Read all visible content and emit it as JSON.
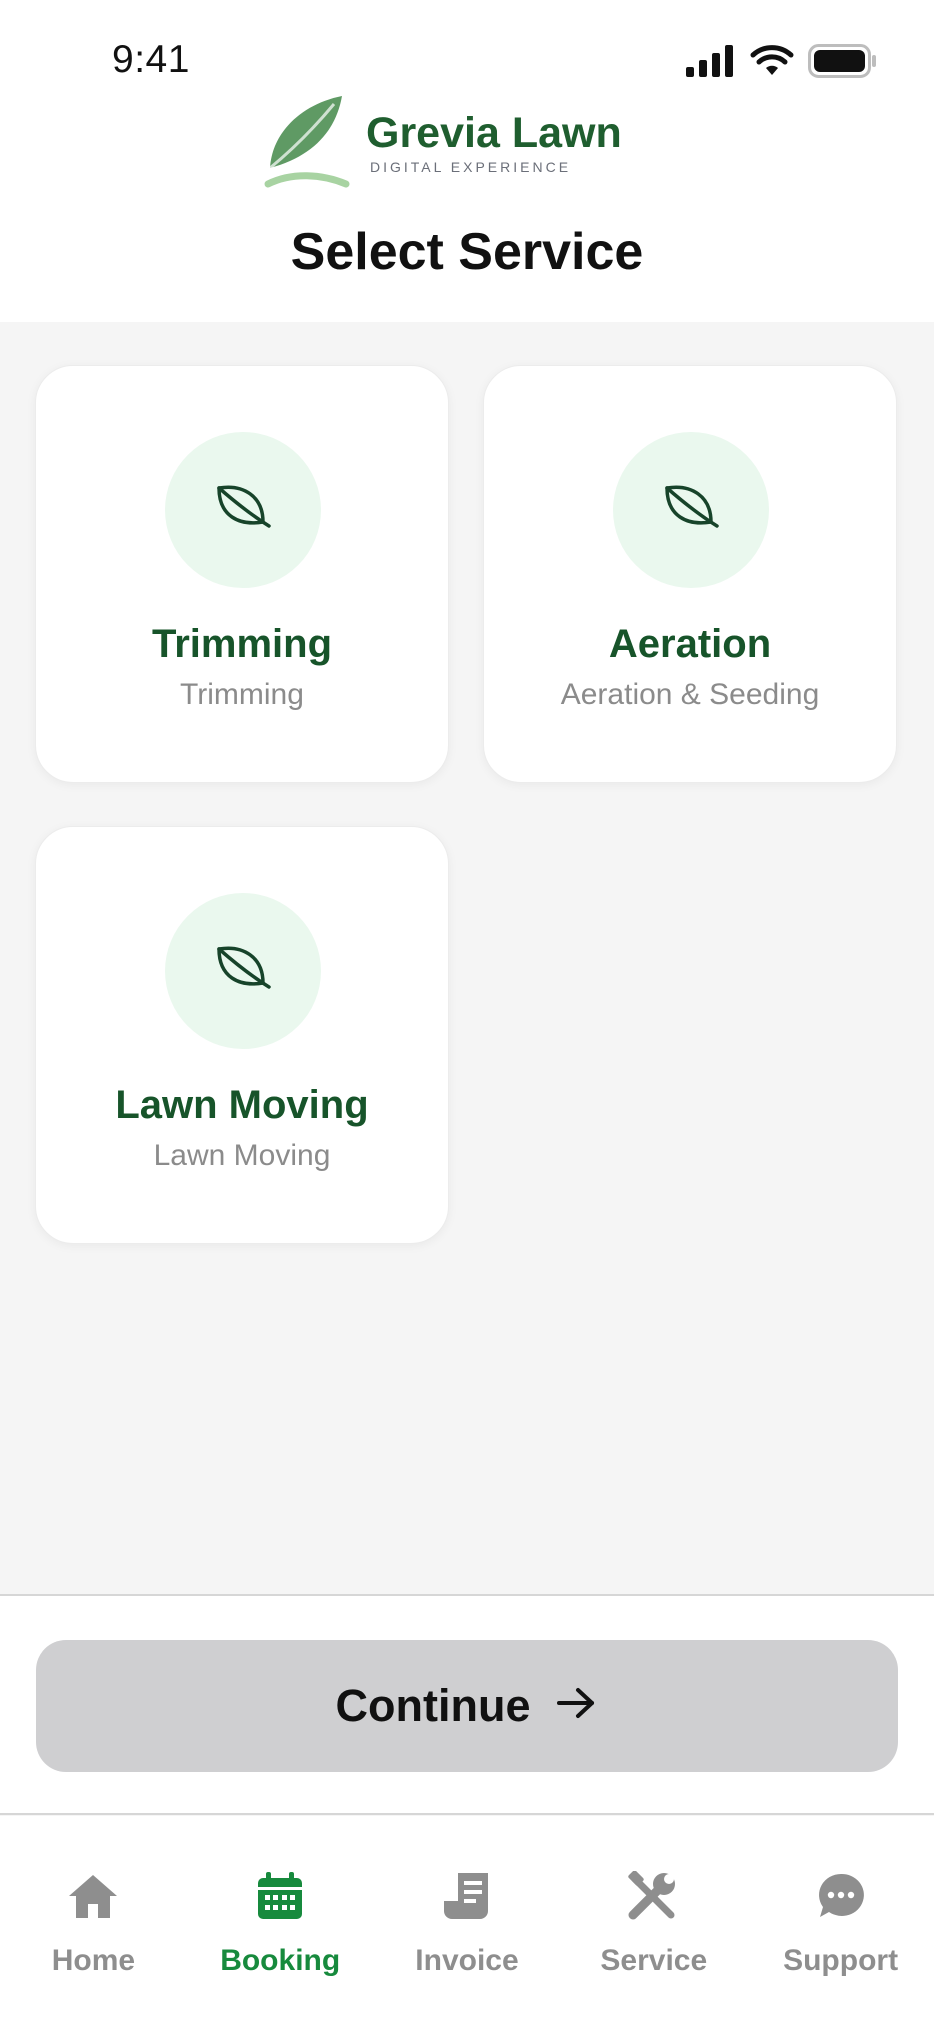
{
  "status_bar": {
    "time": "9:41"
  },
  "brand": {
    "name": "Grevia Lawn",
    "tagline": "DIGITAL EXPERIENCE"
  },
  "page": {
    "title": "Select Service"
  },
  "services": [
    {
      "title": "Trimming",
      "subtitle": "Trimming",
      "icon": "leaf-icon"
    },
    {
      "title": "Aeration",
      "subtitle": "Aeration & Seeding",
      "icon": "leaf-icon"
    },
    {
      "title": "Lawn Moving",
      "subtitle": "Lawn Moving",
      "icon": "leaf-icon"
    }
  ],
  "continue_button": {
    "label": "Continue",
    "icon": "arrow-right-icon"
  },
  "bottom_nav": {
    "items": [
      {
        "label": "Home",
        "icon": "home-icon",
        "active": false
      },
      {
        "label": "Booking",
        "icon": "calendar-icon",
        "active": true
      },
      {
        "label": "Invoice",
        "icon": "invoice-icon",
        "active": false
      },
      {
        "label": "Service",
        "icon": "tools-icon",
        "active": false
      },
      {
        "label": "Support",
        "icon": "chat-icon",
        "active": false
      }
    ]
  },
  "colors": {
    "brand_green": "#1f5e2f",
    "active_green": "#178a3d",
    "icon_circle": "#eaf8ee",
    "button_disabled": "#cfcfd1",
    "inactive": "#8e8e8e"
  }
}
